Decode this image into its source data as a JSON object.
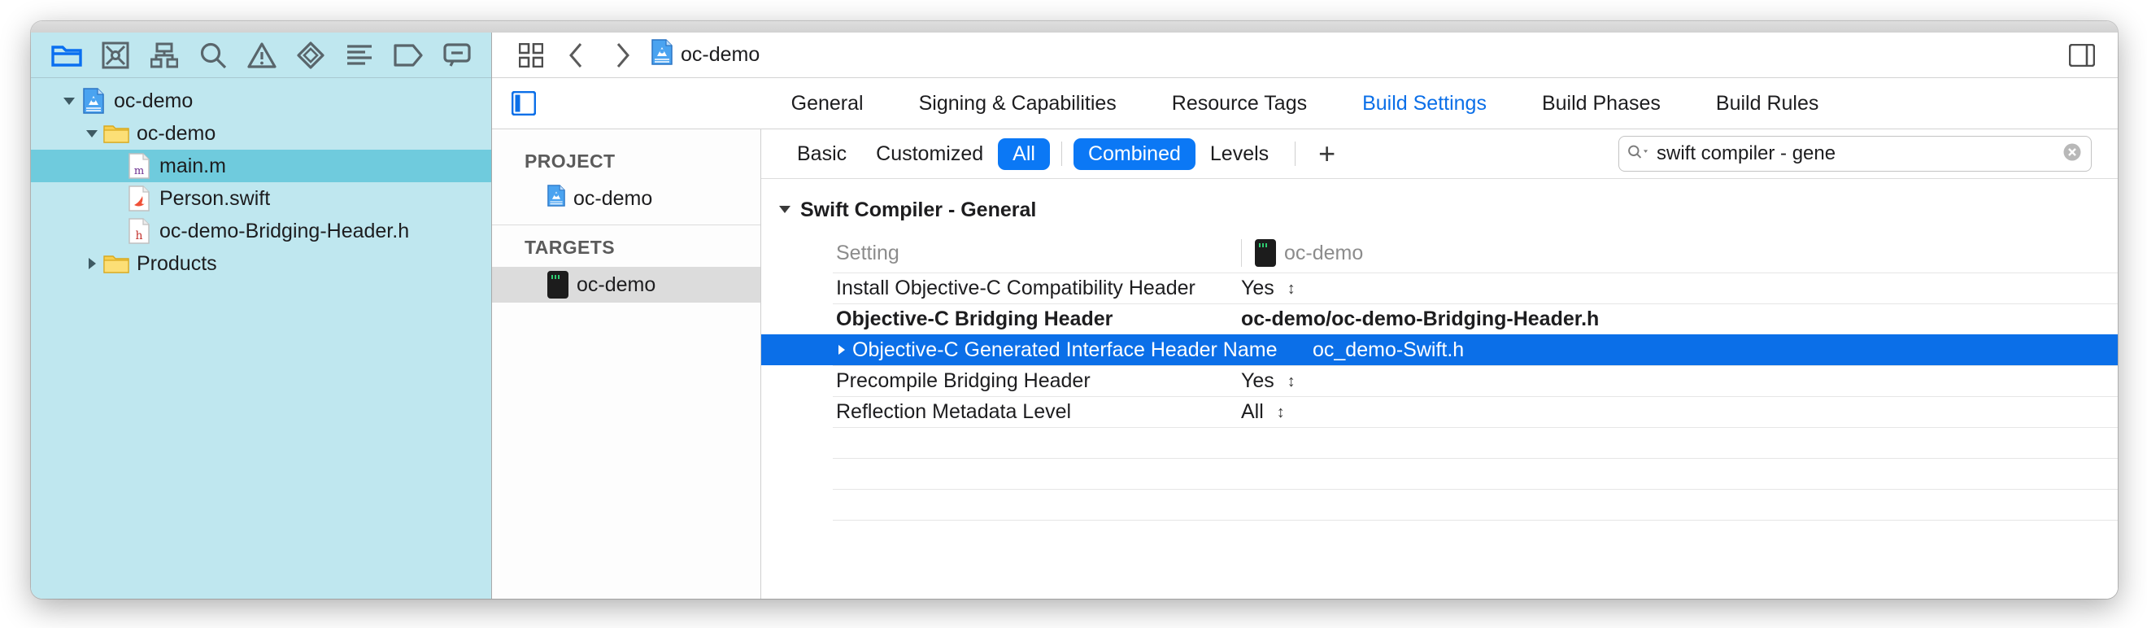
{
  "navigator": {
    "toolbar_icons": [
      "folder-icon",
      "source-control-icon",
      "hierarchy-icon",
      "search-icon",
      "warning-icon",
      "debug-icon",
      "breakpoint-icon",
      "tag-icon",
      "report-icon"
    ],
    "tree": [
      {
        "label": "oc-demo",
        "icon": "xcode-project-icon",
        "indent": 0,
        "twisty": "down",
        "selected": false
      },
      {
        "label": "oc-demo",
        "icon": "folder-icon",
        "indent": 1,
        "twisty": "down",
        "selected": false
      },
      {
        "label": "main.m",
        "icon": "objc-m-file-icon",
        "indent": 2,
        "twisty": "none",
        "selected": true
      },
      {
        "label": "Person.swift",
        "icon": "swift-file-icon",
        "indent": 2,
        "twisty": "none",
        "selected": false
      },
      {
        "label": "oc-demo-Bridging-Header.h",
        "icon": "header-h-file-icon",
        "indent": 2,
        "twisty": "none",
        "selected": false
      },
      {
        "label": "Products",
        "icon": "folder-icon",
        "indent": 1,
        "twisty": "right",
        "selected": false
      }
    ]
  },
  "breadcrumb": {
    "grid_icon": "multi-editor-icon",
    "back_icon": "chevron-left-icon",
    "forward_icon": "chevron-right-icon",
    "file_icon": "xcode-project-icon",
    "file_label": "oc-demo",
    "inspector_icon": "toggle-inspector-icon"
  },
  "tabs": {
    "left_icon": "project-navigator-toggle-icon",
    "items": [
      {
        "label": "General",
        "active": false
      },
      {
        "label": "Signing & Capabilities",
        "active": false
      },
      {
        "label": "Resource Tags",
        "active": false
      },
      {
        "label": "Build Settings",
        "active": true
      },
      {
        "label": "Build Phases",
        "active": false
      },
      {
        "label": "Build Rules",
        "active": false
      }
    ]
  },
  "targets_pane": {
    "project_header": "PROJECT",
    "project_items": [
      {
        "label": "oc-demo",
        "icon": "xcode-project-icon",
        "selected": false
      }
    ],
    "targets_header": "TARGETS",
    "target_items": [
      {
        "label": "oc-demo",
        "icon": "app-target-icon",
        "selected": true
      }
    ]
  },
  "filterbar": {
    "buttons": [
      {
        "label": "Basic",
        "active": false
      },
      {
        "label": "Customized",
        "active": false
      },
      {
        "label": "All",
        "active": true
      },
      {
        "label": "Combined",
        "active": true
      },
      {
        "label": "Levels",
        "active": false
      }
    ],
    "add_label": "+",
    "search": {
      "icon": "search-icon",
      "value": "swift compiler - gene",
      "placeholder": "",
      "clear_icon": "clear-circle-icon"
    }
  },
  "settings_table": {
    "section_title": "Swift Compiler - General",
    "section_twisty": "down",
    "col_setting": "Setting",
    "col_target": "oc-demo",
    "col_target_icon": "app-target-icon",
    "rows": [
      {
        "name": "Install Objective-C Compatibility Header",
        "value": "Yes",
        "stepper": true,
        "bold": false,
        "selected": false,
        "disclosure": false
      },
      {
        "name": "Objective-C Bridging Header",
        "value": "oc-demo/oc-demo-Bridging-Header.h",
        "stepper": false,
        "bold": true,
        "selected": false,
        "disclosure": false
      },
      {
        "name": "Objective-C Generated Interface Header Name",
        "value": "oc_demo-Swift.h",
        "stepper": false,
        "bold": false,
        "selected": true,
        "disclosure": true
      },
      {
        "name": "Precompile Bridging Header",
        "value": "Yes",
        "stepper": true,
        "bold": false,
        "selected": false,
        "disclosure": false
      },
      {
        "name": "Reflection Metadata Level",
        "value": "All",
        "stepper": true,
        "bold": false,
        "selected": false,
        "disclosure": false
      }
    ],
    "empty_rows": 4
  },
  "colors": {
    "navigator_bg": "#bfe7ef",
    "selection_blue": "#0b6fe8",
    "accent_blue": "#0b78f5",
    "row_selected_nav": "#6fcbdd"
  }
}
